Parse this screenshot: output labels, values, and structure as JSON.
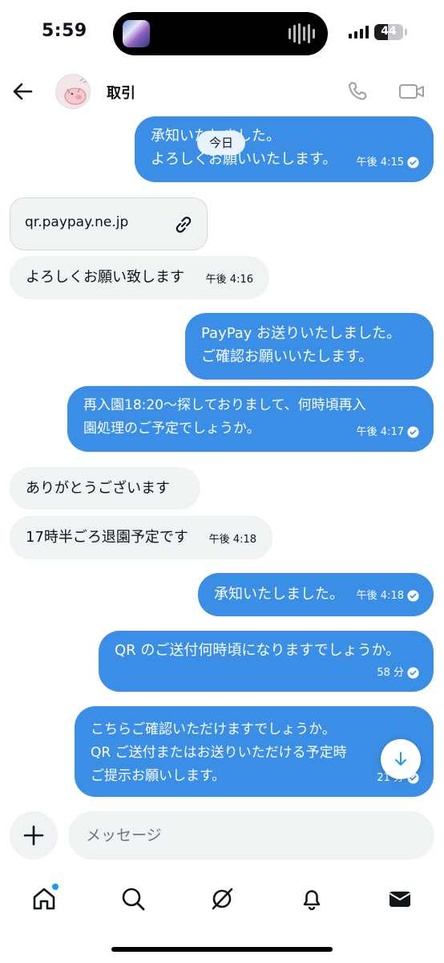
{
  "status_bar": {
    "time": "5:59",
    "battery": "44"
  },
  "header": {
    "title": "取引"
  },
  "day_divider": "今日",
  "messages": [
    {
      "id": "m1",
      "direction": "out",
      "text": "承知いたしました。\nよろしくお願いいたします。",
      "time": "午後 4:15"
    },
    {
      "id": "m2",
      "direction": "in",
      "type": "link",
      "text": "qr.paypay.ne.jp"
    },
    {
      "id": "m3",
      "direction": "in",
      "text": "よろしくお願い致します",
      "time": "午後 4:16"
    },
    {
      "id": "m4",
      "direction": "out",
      "text": "PayPay お送りいたしました。\nご確認お願いいたします。"
    },
    {
      "id": "m5",
      "direction": "out",
      "text": "再入園18:20〜探しておりまして、何時頃再入\n園処理のご予定でしょうか。",
      "time": "午後 4:17"
    },
    {
      "id": "m6",
      "direction": "in",
      "text": "ありがとうございます"
    },
    {
      "id": "m7",
      "direction": "in",
      "text": "17時半ごろ退園予定です",
      "time": "午後 4:18"
    },
    {
      "id": "m8",
      "direction": "out",
      "text": "承知いたしました。",
      "time": "午後 4:18"
    },
    {
      "id": "m9",
      "direction": "out",
      "text": "QR のご送付何時頃になりますでしょうか。",
      "time": "58 分"
    },
    {
      "id": "m10",
      "direction": "out",
      "text": "こちらご確認いただけますでしょうか。\nQR ご送付またはお送りいただける予定時\nご提示お願いします。",
      "time": "21 分"
    }
  ],
  "composer": {
    "placeholder": "メッセージ"
  },
  "colors": {
    "outgoing_bubble": "#3a8ee6",
    "incoming_bubble": "#eff3f4",
    "accent": "#1d9bf0"
  },
  "nav_items": [
    "home-icon",
    "search-icon",
    "grok-icon",
    "bell-icon",
    "mail-icon"
  ]
}
